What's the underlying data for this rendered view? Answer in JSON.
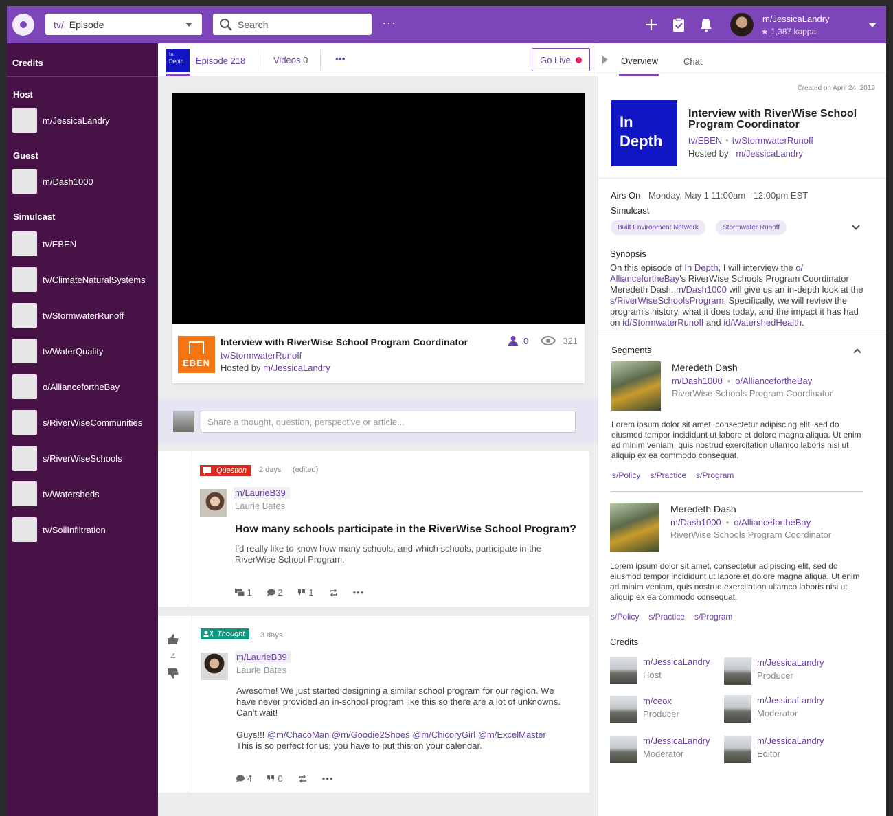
{
  "topbar": {
    "scope_prefix": "tv/",
    "scope_value": "Episode",
    "search_placeholder": "Search",
    "user_name": "m/JessicaLandry",
    "karma": "★ 1,387 kappa"
  },
  "sidebar": {
    "title": "Credits",
    "host_heading": "Host",
    "host": "m/JessicaLandry",
    "guest_heading": "Guest",
    "guest": "m/Dash1000",
    "simulcast_heading": "Simulcast",
    "simulcast": [
      "tv/EBEN",
      "tv/ClimateNaturalSystems",
      "tv/StormwaterRunoff",
      "tv/WaterQuality",
      "o/AlliancefortheBay",
      "s/RiverWiseCommunities",
      "s/RiverWiseSchools",
      "tv/Watersheds",
      "tv/SoilInfiltration"
    ]
  },
  "tabs": {
    "badge_line1": "In",
    "badge_line2": "Depth",
    "episode": "Episode 218",
    "videos_label": "Videos",
    "videos_count": "0",
    "go_live": "Go Live"
  },
  "video": {
    "badge": "EBEN",
    "title": "Interview with RiverWise School Program Coordinator",
    "channel": "tv/StormwaterRunoff",
    "hosted_by": "Hosted by",
    "host": "m/JessicaLandry",
    "participants": "0",
    "views": "321"
  },
  "share": {
    "placeholder": "Share a thought, question, perspective or article..."
  },
  "posts": [
    {
      "tag": "Question",
      "age": "2 days",
      "edited": "(edited)",
      "user": "m/LaurieB39",
      "real_name": "Laurie Bates",
      "title": "How many schools participate in the RiverWise School Program?",
      "body": "I'd really like to know how many schools, and which schools, participate in the RiverWise School Program.",
      "answers": "1",
      "comments": "2",
      "quotes": "1"
    },
    {
      "tag": "Thought",
      "age": "3 days",
      "user": "m/LaurieB39",
      "real_name": "Laurie Bates",
      "votes": "4",
      "body1": "Awesome! We just started designing a similar school program for our region. We have never provided an in-school program like this so there are a lot of unknowns. Can't wait!",
      "body2_prefix": "Guys!!!",
      "mentions": "@m/ChacoMan @m/Goodie2Shoes @m/ChicoryGirl @m/ExcelMaster",
      "body3": "This is so perfect for us, you have to put this on your calendar.",
      "comments": "4",
      "quotes": "0"
    }
  ],
  "panel": {
    "tab_overview": "Overview",
    "tab_chat": "Chat",
    "created": "Created on April 24, 2019",
    "badge_line1": "In",
    "badge_line2": "Depth",
    "title": "Interview with RiverWise School Program Coordinator",
    "chan1": "tv/EBEN",
    "chan2": "tv/StormwaterRunoff",
    "hosted_by": "Hosted by",
    "host": "m/JessicaLandry",
    "airs_label": "Airs On",
    "airs_value": "Monday, May 1 11:00am - 12:00pm EST",
    "simulcast_label": "Simulcast",
    "simulcast_chips": [
      "Built Environment Network",
      "Stormwater Runoff"
    ],
    "synopsis_label": "Synopsis",
    "syn": {
      "t1": "On this episode of ",
      "l1": "In Depth",
      "t2": ", I will interview the ",
      "l2": "o/ AlliancefortheBay",
      "t3": "'s RiverWise Schools Program Coordinator Meredeth Dash. ",
      "l3": "m/Dash1000",
      "t4": " will give us an in-depth look at the ",
      "l4": "s/RiverWiseSchoolsProgram",
      "t5": ". Specifically, we will review the program's history, what it does today, and the impact it has had on ",
      "l5": "id/StormwaterRunoff",
      "t6": " and ",
      "l6": "id/WatershedHealth",
      "t7": "."
    },
    "segments_label": "Segments",
    "segments": [
      {
        "name": "Meredeth Dash",
        "user": "m/Dash1000",
        "org": "o/AlliancefortheBay",
        "role": "RiverWise Schools Program Coordinator",
        "lorem": "Lorem ipsum dolor sit amet, consectetur adipiscing elit, sed do eiusmod tempor incididunt ut labore et dolore magna aliqua. Ut enim ad minim veniam, quis nostrud exercitation ullamco laboris nisi ut aliquip ex ea commodo consequat.",
        "tags": [
          "s/Policy",
          "s/Practice",
          "s/Program"
        ]
      },
      {
        "name": "Meredeth Dash",
        "user": "m/Dash1000",
        "org": "o/AlliancefortheBay",
        "role": "RiverWise Schools Program Coordinator",
        "lorem": "Lorem ipsum dolor sit amet, consectetur adipiscing elit, sed do eiusmod tempor incididunt ut labore et dolore magna aliqua. Ut enim ad minim veniam, quis nostrud exercitation ullamco laboris nisi ut aliquip ex ea commodo consequat.",
        "tags": [
          "s/Policy",
          "s/Practice",
          "s/Program"
        ]
      }
    ],
    "credits_label": "Credits",
    "credits": [
      {
        "name": "m/JessicaLandry",
        "role": "Host"
      },
      {
        "name": "m/JessicaLandry",
        "role": "Producer"
      },
      {
        "name": "m/ceox",
        "role": "Producer"
      },
      {
        "name": "m/JessicaLandry",
        "role": "Moderator"
      },
      {
        "name": "m/JessicaLandry",
        "role": "Moderator"
      },
      {
        "name": "m/JessicaLandry",
        "role": "Editor"
      }
    ]
  }
}
